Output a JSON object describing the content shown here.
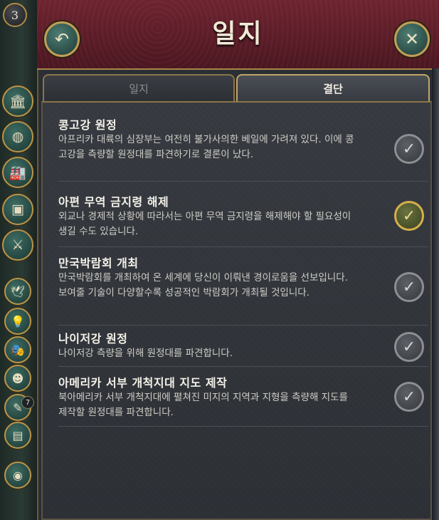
{
  "header": {
    "title": "일지",
    "back_icon": "↶",
    "close_icon": "✕"
  },
  "sidebar": {
    "level": "3",
    "icons": [
      {
        "name": "government-icon",
        "glyph": "🏛"
      },
      {
        "name": "treasury-icon",
        "glyph": "◍"
      },
      {
        "name": "industry-icon",
        "glyph": "🏭"
      },
      {
        "name": "trade-icon",
        "glyph": "▣"
      },
      {
        "name": "military-icon",
        "glyph": "⚔"
      },
      {
        "name": "diplomacy-icon",
        "glyph": "🕊"
      },
      {
        "name": "technology-icon",
        "glyph": "💡"
      },
      {
        "name": "culture-icon",
        "glyph": "🎭"
      },
      {
        "name": "population-icon",
        "glyph": "☻"
      },
      {
        "name": "journal-icon",
        "glyph": "✎"
      },
      {
        "name": "documents-icon",
        "glyph": "▤"
      },
      {
        "name": "world-icon",
        "glyph": "◉"
      }
    ],
    "journal_count": "7"
  },
  "tabs": {
    "journal": "일지",
    "decisions": "결단"
  },
  "decisions": [
    {
      "title": "콩고강 원정",
      "desc": "아프리카 대륙의 심장부는 여전히 불가사의한 베일에 가려져 있다. 이에 콩고강을 측량할 원정대를 파견하기로 결론이 났다.",
      "checked": false
    },
    {
      "title": "아편 무역 금지령 해제",
      "desc": "외교나 경제적 상황에 따라서는 아편 무역 금지령을 해제해야 할 필요성이 생길 수도 있습니다.",
      "checked": true
    },
    {
      "title": "만국박람회 개최",
      "desc": "만국박람회를 개최하여 온 세계에 당신이 이뤄낸 경이로움을 선보입니다. 보여줄 기술이 다양할수록 성공적인 박람회가 개최될 것입니다.",
      "checked": false
    },
    {
      "title": "나이저강 원정",
      "desc": "나이저강 측량을 위해 원정대를 파견합니다.",
      "checked": false
    },
    {
      "title": "아메리카 서부 개척지대 지도 제작",
      "desc": "북아메리카 서부 개척지대에 펼쳐진 미지의 지역과 지형을 측량해 지도를 제작할 원정대를 파견합니다.",
      "checked": false
    }
  ],
  "check_glyph": "✓"
}
